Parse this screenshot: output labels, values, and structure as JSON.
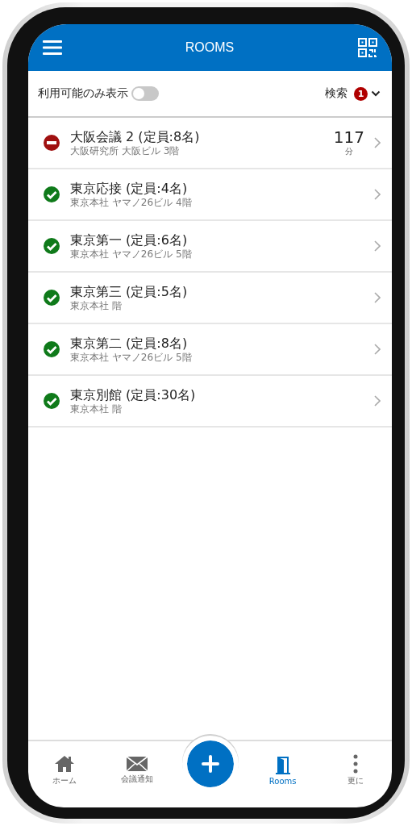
{
  "header": {
    "title": "ROOMS"
  },
  "filter": {
    "label": "利用可能のみ表示",
    "on": false,
    "search_label": "検索",
    "badge": "1"
  },
  "rooms": [
    {
      "name": "大阪会議 2 (定員:8名)",
      "location": "大阪研究所 大阪ビル 3階",
      "available": false,
      "minutes": "117",
      "unit": "分"
    },
    {
      "name": "東京応接 (定員:4名)",
      "location": "東京本社 ヤマノ26ビル 4階",
      "available": true
    },
    {
      "name": "東京第一 (定員:6名)",
      "location": "東京本社 ヤマノ26ビル 5階",
      "available": true
    },
    {
      "name": "東京第三 (定員:5名)",
      "location": "東京本社 階",
      "available": true
    },
    {
      "name": "東京第二 (定員:8名)",
      "location": "東京本社 ヤマノ26ビル 5階",
      "available": true
    },
    {
      "name": "東京別館 (定員:30名)",
      "location": "東京本社 階",
      "available": true
    }
  ],
  "nav": [
    {
      "kind": "home",
      "label": "ホーム",
      "selected": false
    },
    {
      "kind": "mail",
      "label": "会議通知",
      "selected": false
    },
    {
      "kind": "add",
      "selected": false
    },
    {
      "kind": "rooms",
      "label": "Rooms",
      "selected": true
    },
    {
      "kind": "more",
      "label": "更に",
      "selected": false
    }
  ]
}
